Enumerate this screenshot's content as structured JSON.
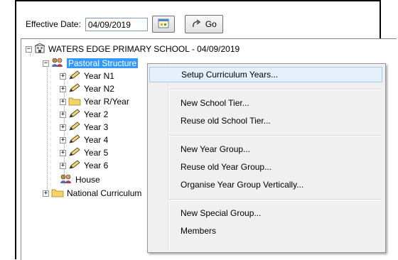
{
  "toolbar": {
    "effective_date_label": "Effective Date:",
    "date_value": "04/09/2019",
    "calendar_icon": "calendar-icon",
    "go_label": "Go",
    "go_icon": "redo-arrow-icon"
  },
  "tree": {
    "root": "WATERS EDGE PRIMARY SCHOOL - 04/09/2019",
    "pastoral": "Pastoral Structure",
    "years": [
      "Year N1",
      "Year N2",
      "Year R/Year",
      "Year 2",
      "Year 3",
      "Year 4",
      "Year 5",
      "Year 6"
    ],
    "house": "House",
    "national": "National Curriculum"
  },
  "context_menu": {
    "items": [
      "Setup Curriculum Years...",
      "New School Tier...",
      "Reuse old School Tier...",
      "New Year Group...",
      "Reuse old Year Group...",
      "Organise Year Group Vertically...",
      "New Special Group...",
      "Members"
    ]
  },
  "colors": {
    "selection": "#3399ff",
    "menu_hover": "#e5f0fb",
    "folder": "#f5d36b"
  }
}
